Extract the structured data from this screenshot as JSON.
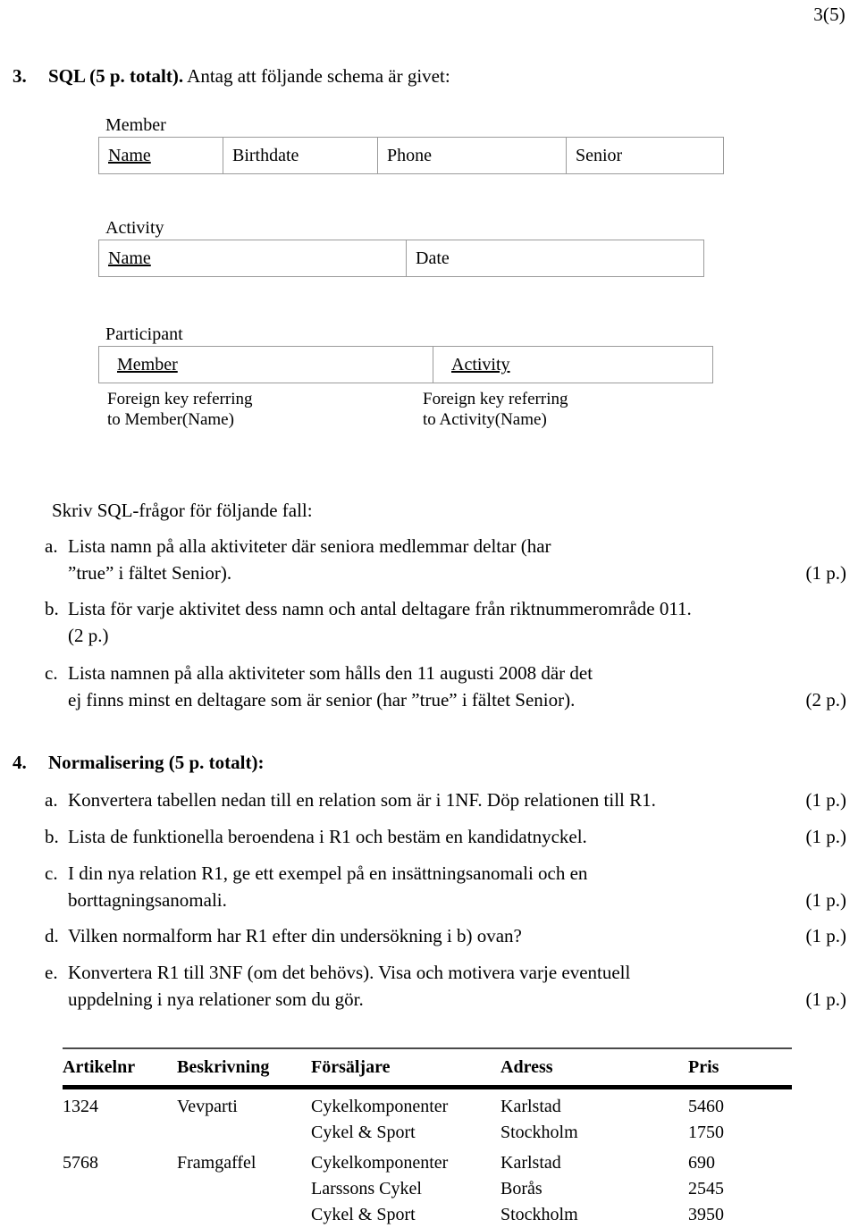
{
  "page": {
    "number_label": "3(5)"
  },
  "sections": [
    {
      "num": "3.",
      "bold_title": "SQL (5 p. totalt).",
      "rest": " Antag att följande schema är givet:"
    },
    {
      "num": "4.",
      "bold_title": "Normalisering (5 p. totalt):",
      "rest": ""
    }
  ],
  "schema": {
    "member": {
      "label": "Member",
      "columns": [
        "Name",
        "Birthdate",
        "Phone",
        "Senior"
      ],
      "key_columns": [
        "Name"
      ]
    },
    "activity": {
      "label": "Activity",
      "columns": [
        "Name",
        "Date"
      ],
      "key_columns": [
        "Name"
      ]
    },
    "participant": {
      "label": "Participant",
      "columns": [
        "Member",
        "Activity"
      ],
      "key_columns": [
        "Member",
        "Activity"
      ],
      "foreign_key_notes": [
        "Foreign key referring\nto Member(Name)",
        "Foreign key referring\nto Activity(Name)"
      ]
    }
  },
  "sql_section": {
    "intro": "Skriv SQL-frågor för följande fall:",
    "items": [
      {
        "marker": "a.",
        "lines": [
          "Lista namn på alla aktiviteter där seniora medlemmar deltar (har",
          "”true” i fältet Senior)."
        ],
        "points": "(1 p.)",
        "points_line": 1
      },
      {
        "marker": "b.",
        "lines": [
          "Lista för varje aktivitet dess namn och antal deltagare från riktnummerområde 011.",
          "(2 p.)"
        ],
        "points": "",
        "points_line": -1
      },
      {
        "marker": "c.",
        "lines": [
          "Lista namnen på alla aktiviteter som hålls den 11 augusti 2008 där det",
          "ej finns minst en deltagare som är senior (har ”true” i fältet Senior)."
        ],
        "points": "(2 p.)",
        "points_line": 1
      }
    ]
  },
  "normalization_section": {
    "items": [
      {
        "marker": "a.",
        "lines": [
          "Konvertera tabellen nedan till en relation som är i 1NF. Döp relationen till R1."
        ],
        "points": "(1 p.)",
        "points_line": 0
      },
      {
        "marker": "b.",
        "lines": [
          "Lista de funktionella beroendena i R1 och bestäm en kandidatnyckel."
        ],
        "points": "(1 p.)",
        "points_line": 0
      },
      {
        "marker": "c.",
        "lines": [
          "I din nya relation R1, ge ett exempel på en insättningsanomali och en",
          "borttagningsanomali."
        ],
        "points": "(1 p.)",
        "points_line": 1
      },
      {
        "marker": "d.",
        "lines": [
          "Vilken normalform har R1 efter din undersökning i b) ovan?"
        ],
        "points": "(1 p.)",
        "points_line": 0
      },
      {
        "marker": "e.",
        "lines": [
          "Konvertera R1 till 3NF (om det behövs). Visa och motivera varje eventuell",
          "uppdelning i nya relationer som du gör."
        ],
        "points": "(1 p.)",
        "points_line": 1
      }
    ]
  },
  "data_table": {
    "headers": [
      "Artikelnr",
      "Beskrivning",
      "Försäljare",
      "Adress",
      "Pris"
    ],
    "rows": [
      {
        "artikelnr": "1324",
        "beskrivning": "Vevparti",
        "forsaljare": "Cykelkomponenter",
        "adress": "Karlstad",
        "pris": "5460",
        "group_start": true
      },
      {
        "artikelnr": "",
        "beskrivning": "",
        "forsaljare": "Cykel & Sport",
        "adress": "Stockholm",
        "pris": "1750",
        "group_start": false
      },
      {
        "artikelnr": "5768",
        "beskrivning": "Framgaffel",
        "forsaljare": "Cykelkomponenter",
        "adress": "Karlstad",
        "pris": "690",
        "group_start": true
      },
      {
        "artikelnr": "",
        "beskrivning": "",
        "forsaljare": "Larssons Cykel",
        "adress": "Borås",
        "pris": "2545",
        "group_start": false
      },
      {
        "artikelnr": "",
        "beskrivning": "",
        "forsaljare": "Cykel & Sport",
        "adress": "Stockholm",
        "pris": "3950",
        "group_start": false
      }
    ]
  }
}
